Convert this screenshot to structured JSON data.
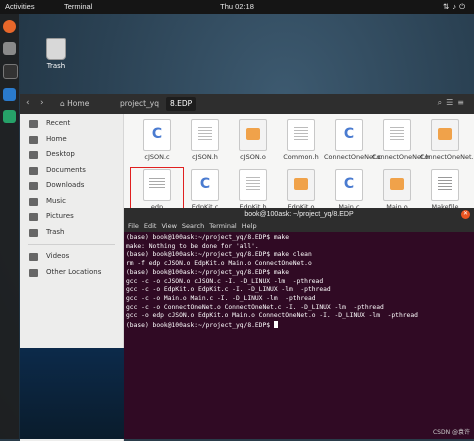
{
  "topbar": {
    "activities": "Activities",
    "app": "Terminal",
    "clock": "Thu 02:18",
    "sys_icons": [
      "network-icon",
      "volume-icon",
      "power-icon"
    ]
  },
  "desktop": {
    "trash_label": "Trash"
  },
  "dock": {
    "items": [
      "firefox-icon",
      "files-icon",
      "terminal-icon",
      "vscode-icon",
      "jetbrains-icon"
    ]
  },
  "nautilus": {
    "breadcrumbs": [
      "Home",
      "project_yq",
      "8.EDP"
    ],
    "sidebar": [
      {
        "label": "Recent",
        "icon": "clock-icon"
      },
      {
        "label": "Home",
        "icon": "home-icon"
      },
      {
        "label": "Desktop",
        "icon": "desktop-icon"
      },
      {
        "label": "Documents",
        "icon": "documents-icon"
      },
      {
        "label": "Downloads",
        "icon": "downloads-icon"
      },
      {
        "label": "Music",
        "icon": "music-icon"
      },
      {
        "label": "Pictures",
        "icon": "pictures-icon"
      },
      {
        "label": "Trash",
        "icon": "trash-icon"
      },
      {
        "label": "Videos",
        "icon": "videos-icon"
      },
      {
        "label": "Other Locations",
        "icon": "plus-icon"
      }
    ],
    "files": [
      {
        "name": "cJSON.c",
        "type": "c"
      },
      {
        "name": "cJSON.h",
        "type": "h"
      },
      {
        "name": "cJSON.o",
        "type": "o"
      },
      {
        "name": "Common.h",
        "type": "h"
      },
      {
        "name": "ConnectOneNet.c",
        "type": "c"
      },
      {
        "name": "ConnectOneNet.h",
        "type": "h"
      },
      {
        "name": "ConnectOneNet.o",
        "type": "o"
      },
      {
        "name": "edp",
        "type": "exe",
        "selected": true
      },
      {
        "name": "EdpKit.c",
        "type": "c"
      },
      {
        "name": "EdpKit.h",
        "type": "h"
      },
      {
        "name": "EdpKit.o",
        "type": "o"
      },
      {
        "name": "Main.c",
        "type": "c"
      },
      {
        "name": "Main.o",
        "type": "o"
      },
      {
        "name": "Makefile",
        "type": "mk"
      }
    ]
  },
  "terminal": {
    "title": "book@100ask: ~/project_yq/8.EDP",
    "menu": [
      "File",
      "Edit",
      "View",
      "Search",
      "Terminal",
      "Help"
    ],
    "lines": [
      "(base) book@100ask:~/project_yq/8.EDP$ make",
      "make: Nothing to be done for 'all'.",
      "(base) book@100ask:~/project_yq/8.EDP$ make clean",
      "rm -f edp cJSON.o EdpKit.o Main.o ConnectOneNet.o",
      "(base) book@100ask:~/project_yq/8.EDP$ make",
      "gcc -c -o cJSON.o cJSON.c -I. -D_LINUX -lm  -pthread",
      "gcc -c -o EdpKit.o EdpKit.c -I. -D_LINUX -lm  -pthread",
      "gcc -c -o Main.o Main.c -I. -D_LINUX -lm  -pthread",
      "gcc -c -o ConnectOneNet.o ConnectOneNet.c -I. -D_LINUX -lm  -pthread",
      "gcc -o edp cJSON.o EdpKit.o Main.o ConnectOneNet.o -I. -D_LINUX -lm  -pthread",
      "(base) book@100ask:~/project_yq/8.EDP$ "
    ]
  },
  "watermark": "CSDN @袁许"
}
